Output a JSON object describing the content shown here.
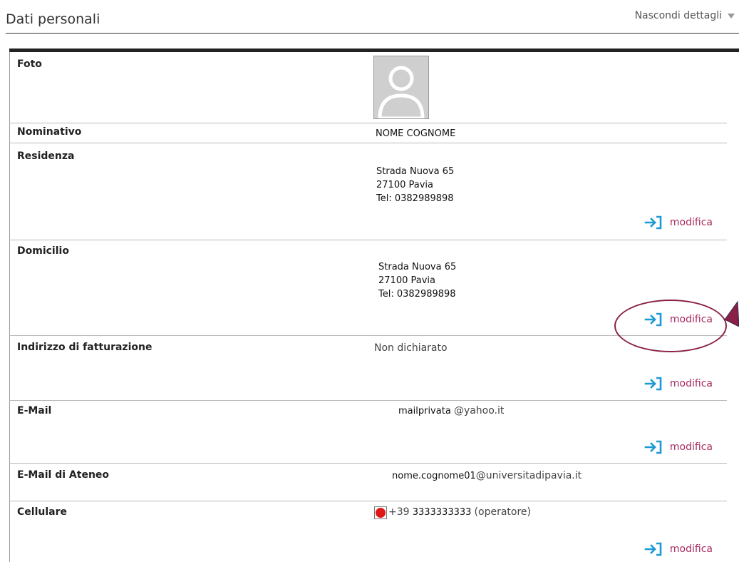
{
  "header": {
    "title": "Dati personali",
    "hide_details": "Nascondi dettagli"
  },
  "photo": {
    "label": "Foto"
  },
  "name": {
    "label": "Nominativo",
    "value": "NOME COGNOME"
  },
  "residence": {
    "label": "Residenza",
    "line1": "Strada Nuova 65",
    "line2": "27100 Pavia",
    "line3": "Tel: 0382989898",
    "edit": "modifica"
  },
  "domicile": {
    "label": "Domicilio",
    "line1": "Strada Nuova 65",
    "line2": "27100 Pavia",
    "line3": "Tel: 0382989898",
    "edit": "modifica"
  },
  "billing": {
    "label": "Indirizzo di fatturazione",
    "value": "Non dichiarato",
    "edit": "modifica"
  },
  "email": {
    "label": "E-Mail",
    "value_user": "mailprivata",
    "value_domain": "@yahoo.it",
    "edit": "modifica"
  },
  "uni_email": {
    "label": "E-Mail di Ateneo",
    "value_user": "nome.cognome01",
    "value_domain": "@universitadipavia.it"
  },
  "mobile": {
    "label": "Cellulare",
    "prefix": "+39",
    "number": "3333333333",
    "operator": "(operatore)",
    "edit": "modifica"
  },
  "colors": {
    "link": "#a82a5f",
    "icon": "#1c9ad6",
    "annotation": "#8a1f48",
    "flag": "#e01717"
  }
}
